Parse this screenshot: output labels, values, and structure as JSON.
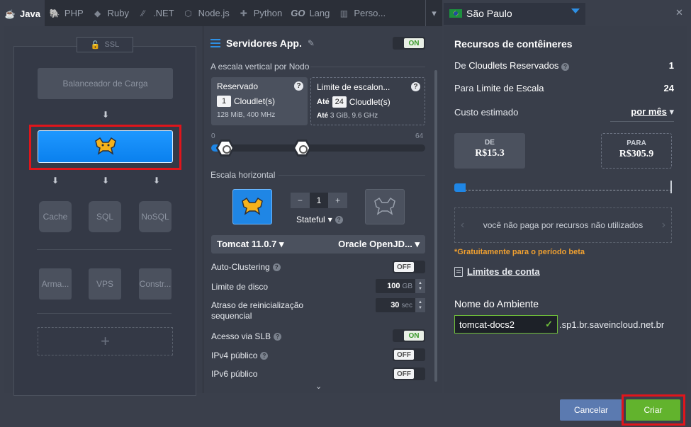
{
  "tabs": [
    {
      "label": "Java",
      "icon": "java-icon"
    },
    {
      "label": "PHP",
      "icon": "php-icon"
    },
    {
      "label": "Ruby",
      "icon": "ruby-icon"
    },
    {
      "label": ".NET",
      "icon": "dotnet-icon"
    },
    {
      "label": "Node.js",
      "icon": "nodejs-icon"
    },
    {
      "label": "Python",
      "icon": "python-icon"
    },
    {
      "label": "Lang",
      "icon": "go-icon"
    },
    {
      "label": "Perso...",
      "icon": "custom-icon"
    }
  ],
  "go_prefix": "GO",
  "region": {
    "name": "São Paulo",
    "flag": "brazil-flag-icon"
  },
  "topology": {
    "ssl_label": "SSL",
    "load_balancer": "Balanceador de Carga",
    "cache": "Cache",
    "sql": "SQL",
    "nosql": "NoSQL",
    "storage": "Arma...",
    "vps": "VPS",
    "build": "Constr...",
    "add": "+"
  },
  "settings": {
    "title": "Servidores App.",
    "toggle_main": "ON",
    "vertical_label": "A escala vertical por Nodo",
    "reserved": {
      "title": "Reservado",
      "value": "1",
      "unit": "Cloudlet(s)",
      "spec": "128 MiB, 400 MHz"
    },
    "limit": {
      "title": "Limite de escalon...",
      "prefix": "Até",
      "value": "24",
      "unit": "Cloudlet(s)",
      "spec_prefix": "Até",
      "spec": "3 GiB, 9.6 GHz"
    },
    "scale_min": "0",
    "scale_max": "64",
    "reserved_fraction": 0.016,
    "limit_fraction": 0.375,
    "horizontal_label": "Escala horizontal",
    "node_count": "1",
    "minus": "−",
    "plus": "+",
    "stateful": "Stateful",
    "server": "Tomcat 11.0.7",
    "jdk": "Oracle OpenJD...",
    "auto_clustering": {
      "label": "Auto-Clustering",
      "state": "OFF"
    },
    "disk": {
      "label": "Limite de disco",
      "value": "100",
      "unit": "GB"
    },
    "restart": {
      "label_1": "Atraso de reinicialização",
      "label_2": "sequencial",
      "value": "30",
      "unit": "sec"
    },
    "slb": {
      "label": "Acesso via SLB",
      "state": "ON"
    },
    "ipv4": {
      "label": "IPv4 público",
      "state": "OFF"
    },
    "ipv6": {
      "label": "IPv6 público",
      "state": "OFF"
    }
  },
  "resources": {
    "title": "Recursos de contêineres",
    "reserved_prefix": "De",
    "reserved_label": "Cloudlets Reservados",
    "reserved_value": "1",
    "limit_prefix": "Para",
    "limit_label": "Limite de Escala",
    "limit_value": "24",
    "cost_label": "Custo estimado",
    "cost_period": "por mês",
    "from_label": "DE",
    "from_value": "R$15.3",
    "to_label": "PARA",
    "to_value": "R$305.9",
    "note": "você não paga por recursos não utilizados",
    "free_note": "*Gratuitamente para o período beta",
    "account_limits": "Limites de conta",
    "env_label": "Nome do Ambiente",
    "env_value": "tomcat-docs2",
    "env_suffix": ".sp1.br.saveincloud.net.br"
  },
  "footer": {
    "cancel": "Cancelar",
    "create": "Criar"
  },
  "colors": {
    "accent": "#1f86e5",
    "create": "#62b32d",
    "cancel": "#5b7ab0",
    "highlight": "#e0151b",
    "warning": "#f0a030"
  }
}
